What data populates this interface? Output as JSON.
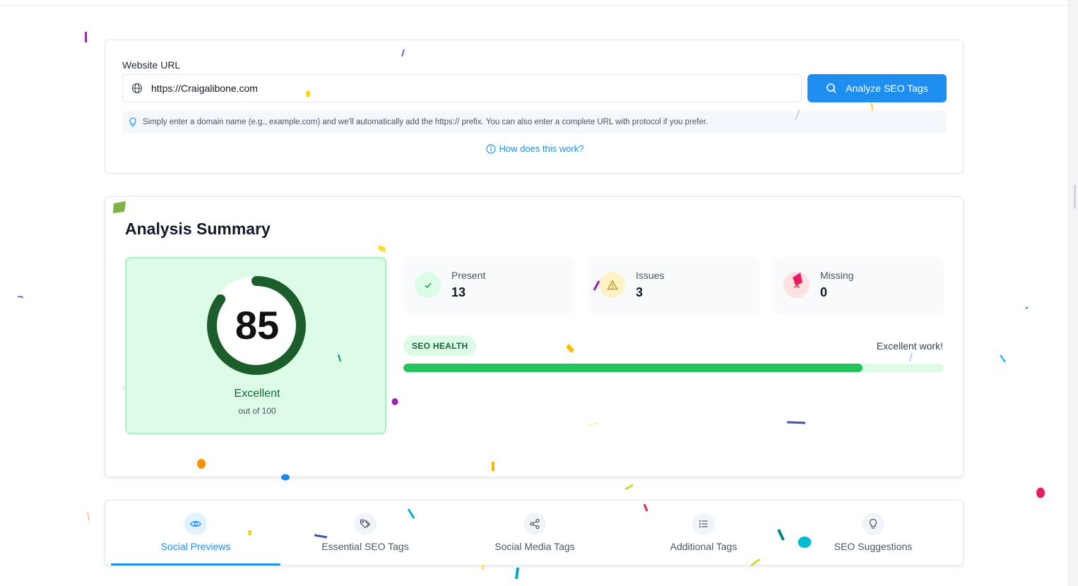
{
  "url_form": {
    "label": "Website URL",
    "url_value": "https://Craigalibone.com",
    "analyze_button": "Analyze SEO Tags",
    "hint": "Simply enter a domain name (e.g., example.com) and we'll automatically add the https:// prefix. You can also enter a complete URL with protocol if you prefer.",
    "how_link": "How does this work?"
  },
  "summary": {
    "title": "Analysis Summary",
    "score": "85",
    "score_fraction": 0.85,
    "score_label": "Excellent",
    "score_sub": "out of 100",
    "stats": [
      {
        "label": "Present",
        "value": "13",
        "icon": "check-icon",
        "color": "#16a34a"
      },
      {
        "label": "Issues",
        "value": "3",
        "icon": "warning-icon",
        "color": "#ca8a04"
      },
      {
        "label": "Missing",
        "value": "0",
        "icon": "x-icon",
        "color": "#dc2626"
      }
    ],
    "health_badge": "SEO HEALTH",
    "health_message": "Excellent work!",
    "health_progress": 0.85
  },
  "tabs": [
    {
      "label": "Social Previews",
      "icon": "eye-icon",
      "active": true
    },
    {
      "label": "Essential SEO Tags",
      "icon": "tag-icon",
      "active": false
    },
    {
      "label": "Social Media Tags",
      "icon": "share-icon",
      "active": false
    },
    {
      "label": "Additional Tags",
      "icon": "list-icon",
      "active": false
    },
    {
      "label": "SEO Suggestions",
      "icon": "lightbulb-icon",
      "active": false
    }
  ],
  "colors": {
    "accent": "#1e8ff0",
    "score_ring": "#1b5e2b",
    "success": "#22c55e"
  }
}
